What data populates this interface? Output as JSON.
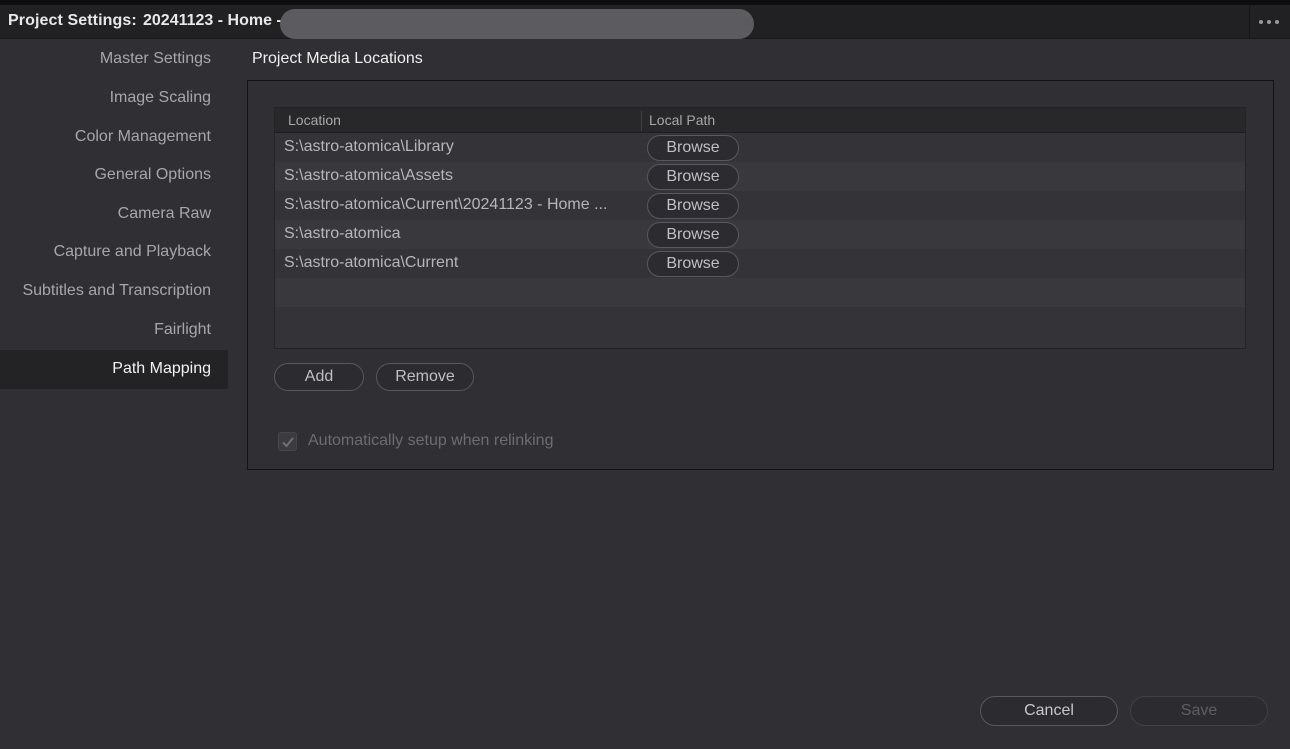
{
  "titlebar": {
    "label": "Project Settings:",
    "project_name": "20241123 - Home -"
  },
  "sidebar": {
    "items": [
      {
        "label": "Master Settings"
      },
      {
        "label": "Image Scaling"
      },
      {
        "label": "Color Management"
      },
      {
        "label": "General Options"
      },
      {
        "label": "Camera Raw"
      },
      {
        "label": "Capture and Playback"
      },
      {
        "label": "Subtitles and Transcription"
      },
      {
        "label": "Fairlight"
      },
      {
        "label": "Path Mapping",
        "active": true
      }
    ]
  },
  "main": {
    "section_title": "Project Media Locations",
    "table": {
      "columns": [
        "Location",
        "Local Path"
      ],
      "rows": [
        {
          "location": "S:\\astro-atomica\\Library",
          "action": "Browse"
        },
        {
          "location": "S:\\astro-atomica\\Assets",
          "action": "Browse"
        },
        {
          "location": "S:\\astro-atomica\\Current\\20241123 - Home ...",
          "action": "Browse"
        },
        {
          "location": "S:\\astro-atomica",
          "action": "Browse"
        },
        {
          "location": "S:\\astro-atomica\\Current",
          "action": "Browse"
        }
      ]
    },
    "add_label": "Add",
    "remove_label": "Remove",
    "auto_setup": {
      "label": "Automatically setup when relinking",
      "checked": true,
      "disabled": true
    }
  },
  "footer": {
    "cancel_label": "Cancel",
    "save_label": "Save"
  },
  "icons": {
    "more": "more-horizontal-icon",
    "check": "checkmark-icon"
  }
}
